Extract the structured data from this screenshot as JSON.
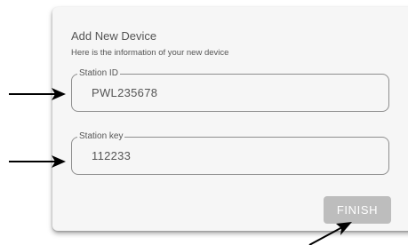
{
  "form": {
    "title": "Add New Device",
    "subtitle": "Here is the information of your new device",
    "station_id": {
      "label": "Station ID",
      "value": "PWL235678"
    },
    "station_key": {
      "label": "Station key",
      "value": "112233"
    },
    "finish_label": "FINISH"
  },
  "colors": {
    "card_background": "#f6f6f6",
    "text": "#555555",
    "field_border": "#8e8e8e",
    "finish_button_background": "#bdbdbd",
    "finish_button_text": "#ffffff",
    "annotation_arrow": "#000000"
  },
  "annotations": {
    "arrow_icons": [
      "arrow-right-icon",
      "arrow-right-icon",
      "arrow-up-right-icon"
    ]
  }
}
